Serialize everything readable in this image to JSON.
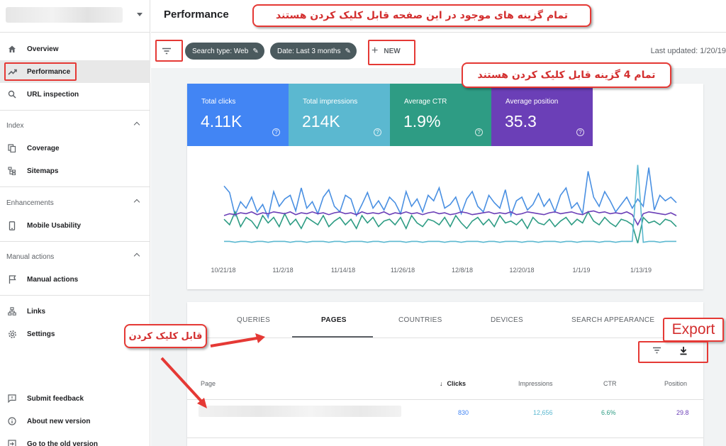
{
  "header": {
    "title": "Performance"
  },
  "sidebar": {
    "items": [
      {
        "label": "Overview",
        "icon": "home-icon"
      },
      {
        "label": "Performance",
        "icon": "trending-icon"
      },
      {
        "label": "URL inspection",
        "icon": "search-icon"
      },
      {
        "label": "Coverage",
        "icon": "copy-icon"
      },
      {
        "label": "Sitemaps",
        "icon": "sitemap-icon"
      },
      {
        "label": "Mobile Usability",
        "icon": "phone-icon"
      },
      {
        "label": "Manual actions",
        "icon": "flag-icon"
      },
      {
        "label": "Links",
        "icon": "links-icon"
      },
      {
        "label": "Settings",
        "icon": "gear-icon"
      },
      {
        "label": "Submit feedback",
        "icon": "feedback-icon"
      },
      {
        "label": "About new version",
        "icon": "info-icon"
      },
      {
        "label": "Go to the old version",
        "icon": "exit-icon"
      }
    ],
    "sections": {
      "index": "Index",
      "enhancements": "Enhancements",
      "manual": "Manual actions"
    }
  },
  "toolbar": {
    "chip_search": "Search type: Web",
    "chip_date": "Date: Last 3 months",
    "new_label": "NEW",
    "last_updated": "Last updated: 1/20/19"
  },
  "metrics": [
    {
      "label": "Total clicks",
      "value": "4.11K",
      "color": "#4285f4"
    },
    {
      "label": "Total impressions",
      "value": "214K",
      "color": "#5bb8d0"
    },
    {
      "label": "Average CTR",
      "value": "1.9%",
      "color": "#2e9c84"
    },
    {
      "label": "Average position",
      "value": "35.3",
      "color": "#6b3fb7"
    }
  ],
  "annotations": {
    "top": "تمام گزینه های موجود در این صفحه قابل کلیک کردن هستند",
    "metrics": "تمام 4 گزینه قابل کلیک کردن هستند",
    "clickable": "قابل کلیک کردن",
    "export": "Export"
  },
  "tabs": [
    "QUERIES",
    "PAGES",
    "COUNTRIES",
    "DEVICES",
    "SEARCH APPEARANCE"
  ],
  "table": {
    "headers": {
      "page": "Page",
      "clicks": "Clicks",
      "impressions": "Impressions",
      "ctr": "CTR",
      "position": "Position"
    },
    "rows": [
      {
        "clicks": "830",
        "impressions": "12,656",
        "ctr": "6.6%",
        "position": "29.8"
      }
    ]
  },
  "chart_data": {
    "type": "line",
    "x_tick_labels": [
      "10/21/18",
      "11/2/18",
      "11/14/18",
      "11/26/18",
      "12/8/18",
      "12/20/18",
      "1/1/19",
      "1/13/19"
    ],
    "series": [
      {
        "color": "#4a90e2",
        "values": [
          72,
          65,
          40,
          55,
          48,
          60,
          44,
          52,
          38,
          66,
          50,
          58,
          62,
          45,
          70,
          48,
          55,
          42,
          60,
          68,
          50,
          44,
          62,
          58,
          40,
          52,
          65,
          48,
          56,
          46,
          60,
          54,
          42,
          66,
          50,
          58,
          44,
          62,
          56,
          70,
          48,
          52,
          60,
          42,
          58,
          66,
          50,
          44,
          62,
          54,
          48,
          68,
          40,
          56,
          60,
          46,
          52,
          64,
          50,
          58,
          44,
          62,
          70,
          48,
          54,
          42,
          88,
          60,
          50,
          66,
          56,
          44,
          52,
          60,
          48,
          58,
          50,
          92,
          46,
          62,
          56,
          60,
          54
        ]
      },
      {
        "color": "#2e9c84",
        "values": [
          36,
          30,
          44,
          28,
          38,
          34,
          26,
          40,
          32,
          38,
          28,
          42,
          30,
          36,
          26,
          38,
          34,
          30,
          40,
          28,
          34,
          38,
          30,
          36,
          26,
          40,
          32,
          38,
          28,
          34,
          36,
          30,
          38,
          26,
          40,
          32,
          28,
          36,
          34,
          30,
          38,
          28,
          40,
          32,
          26,
          34,
          38,
          30,
          36,
          28,
          40,
          32,
          34,
          30,
          36,
          26,
          38,
          32,
          30,
          36,
          28,
          34,
          38,
          30,
          36,
          32,
          44,
          34,
          30,
          38,
          32,
          28,
          36,
          34,
          30,
          10,
          38,
          32,
          34,
          30,
          36,
          34,
          28
        ]
      },
      {
        "color": "#6b3fb7",
        "values": [
          40,
          42,
          41,
          43,
          42,
          44,
          41,
          43,
          42,
          44,
          43,
          42,
          44,
          41,
          43,
          42,
          44,
          42,
          43,
          41,
          43,
          44,
          42,
          43,
          41,
          44,
          42,
          43,
          42,
          44,
          41,
          43,
          42,
          44,
          42,
          43,
          41,
          43,
          44,
          42,
          43,
          41,
          42,
          44,
          43,
          41,
          42,
          43,
          44,
          42,
          43,
          42,
          44,
          41,
          42,
          44,
          43,
          42,
          41,
          43,
          44,
          42,
          43,
          44,
          42,
          41,
          44,
          45,
          43,
          44,
          42,
          43,
          42,
          44,
          41,
          30,
          42,
          44,
          43,
          42,
          41,
          43,
          40
        ]
      },
      {
        "color": "#5bb8d0",
        "values": [
          12,
          12,
          11,
          12,
          12,
          11,
          12,
          12,
          11,
          12,
          12,
          12,
          11,
          12,
          12,
          11,
          12,
          12,
          12,
          11,
          12,
          12,
          11,
          12,
          12,
          12,
          11,
          12,
          12,
          11,
          12,
          12,
          12,
          11,
          12,
          12,
          11,
          12,
          12,
          12,
          11,
          12,
          12,
          11,
          12,
          12,
          12,
          11,
          12,
          12,
          11,
          12,
          12,
          12,
          11,
          12,
          12,
          11,
          12,
          12,
          12,
          11,
          12,
          12,
          11,
          12,
          12,
          12,
          11,
          12,
          12,
          11,
          12,
          12,
          12,
          95,
          11,
          12,
          12,
          11,
          12,
          12,
          12
        ]
      }
    ],
    "grid": false
  }
}
